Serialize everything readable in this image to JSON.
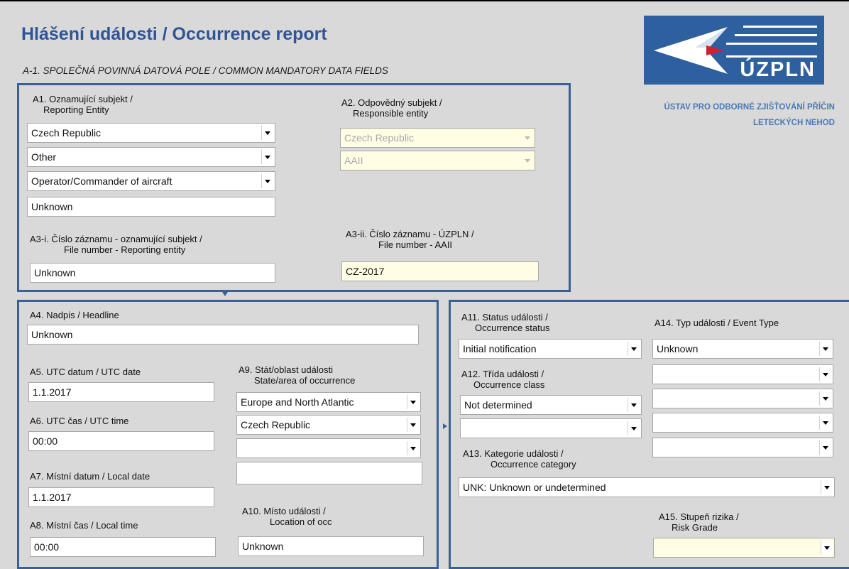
{
  "header": {
    "title": "Hlášení události / Occurrence report",
    "subtitle": "A-1.  SPOLEČNÁ POVINNÁ DATOVÁ POLE  / COMMON MANDATORY DATA FIELDS"
  },
  "logo": {
    "text": "ÚZPLN",
    "org_line1": "ÚSTAV PRO ODBORNÉ ZJIŠŤOVÁNÍ  PŘÍČIN",
    "org_line2": "LETECKÝCH NEHOD"
  },
  "section1": {
    "a1": {
      "label1": "A1. Oznamující subjekt /",
      "label2": "Reporting Entity",
      "country": "Czech Republic",
      "type": "Other",
      "role": "Operator/Commander of aircraft",
      "name": "Unknown"
    },
    "a2": {
      "label1": "A2. Odpovědný subjekt /",
      "label2": "Responsible entity",
      "country": "Czech Republic",
      "entity": "AAII"
    },
    "a3i": {
      "label1": "A3-i. Číslo záznamu - oznamující subjekt /",
      "label2": "File number - Reporting entity",
      "value": "Unknown"
    },
    "a3ii": {
      "label1": "A3-ii. Číslo záznamu - ÚZPLN /",
      "label2": "File number - AAII",
      "value": "CZ-2017"
    }
  },
  "section2": {
    "a4": {
      "label": "A4. Nadpis / Headline",
      "value": "Unknown"
    },
    "a5": {
      "label": "A5. UTC datum / UTC date",
      "value": "1.1.2017"
    },
    "a6": {
      "label": "A6. UTC čas / UTC time",
      "value": "00:00"
    },
    "a7": {
      "label": "A7. Místní datum / Local date",
      "value": "1.1.2017"
    },
    "a8": {
      "label": "A8. Místní čas / Local time",
      "value": "00:00"
    },
    "a9": {
      "label1": "A9. Stát/oblast události",
      "label2": "State/area of occurrence",
      "region": "Europe and North Atlantic",
      "state": "Czech Republic",
      "sub": "",
      "extra": ""
    },
    "a10": {
      "label1": "A10. Místo události /",
      "label2": "Location of occ",
      "value": "Unknown"
    }
  },
  "section3": {
    "a11": {
      "label1": "A11. Status události /",
      "label2": "Occurrence status",
      "value": "Initial notification"
    },
    "a12": {
      "label1": "A12. Třída události /",
      "label2": "Occurrence class",
      "value": "Not determined",
      "value2": ""
    },
    "a13": {
      "label1": "A13. Kategorie události /",
      "label2": "Occurrence category",
      "value": "UNK: Unknown or undetermined"
    },
    "a14": {
      "label": "A14. Typ události / Event Type",
      "values": [
        "Unknown",
        "",
        "",
        "",
        ""
      ]
    },
    "a15": {
      "label1": "A15. Stupeň rizika /",
      "label2": "Risk Grade",
      "value": ""
    }
  },
  "colors": {
    "title": "#2f5597",
    "frame": "#3b6096",
    "logo_bg": "#2e5f9e",
    "logo_accent": "#d3202f",
    "org_text": "#4a7ab5",
    "field_yellow": "#fffde3"
  },
  "icons": [
    "ministry-wing-logo",
    "dropdown-arrow-icon"
  ]
}
